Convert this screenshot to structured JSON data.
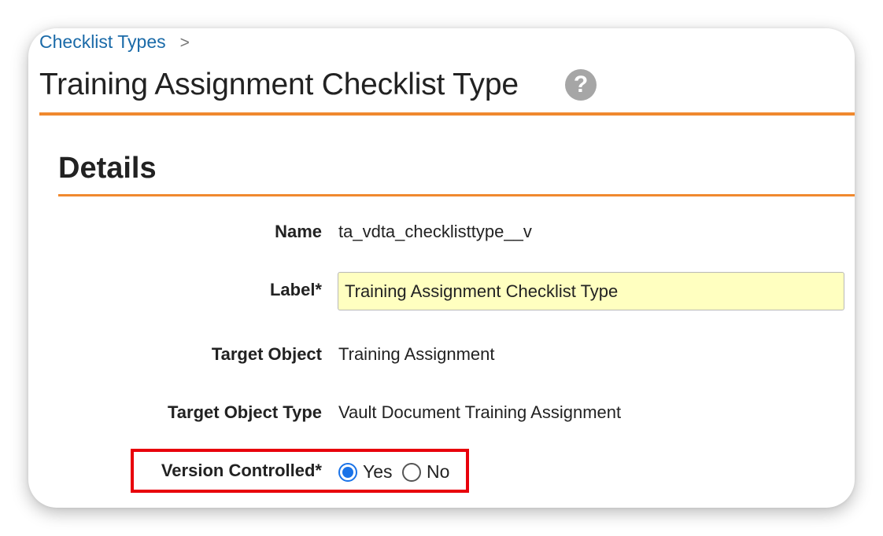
{
  "breadcrumb": {
    "link": "Checklist Types",
    "separator": ">"
  },
  "page": {
    "title": "Training Assignment Checklist Type",
    "help_symbol": "?"
  },
  "section": {
    "title": "Details"
  },
  "fields": {
    "name": {
      "label": "Name",
      "value": "ta_vdta_checklisttype__v"
    },
    "label": {
      "label": "Label*",
      "value": "Training Assignment Checklist Type"
    },
    "target_object": {
      "label": "Target Object",
      "value": "Training Assignment"
    },
    "target_object_type": {
      "label": "Target Object Type",
      "value": "Vault Document Training Assignment"
    },
    "version_controlled": {
      "label": "Version Controlled*",
      "options": [
        "Yes",
        "No"
      ],
      "selected": "Yes"
    }
  },
  "colors": {
    "accent_rule": "#f0892e",
    "link": "#1a6aa8",
    "highlight": "#e8000b",
    "input_bg": "#ffffc0"
  }
}
